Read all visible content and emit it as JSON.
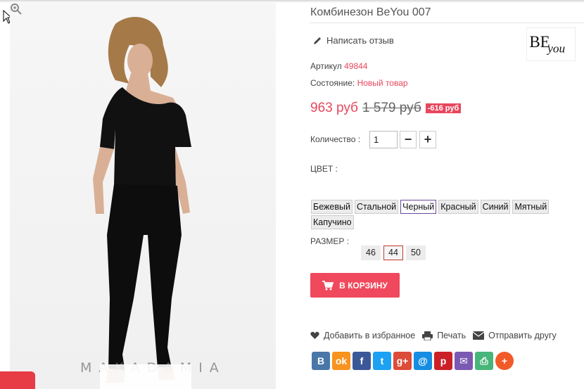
{
  "product": {
    "title": "Комбинезон BeYou 007",
    "review_link": "Написать отзыв",
    "brand_logo_text": "BE you",
    "sku_label": "Артикул",
    "sku_value": "49844",
    "condition_label": "Состояние:",
    "condition_value": "Новый товар",
    "price": "963 руб",
    "old_price": "1 579 руб",
    "discount": "-616 руб",
    "quantity_label": "Количество :",
    "quantity_value": "1",
    "color_label": "ЦВЕТ :",
    "colors": [
      "Бежевый",
      "Стальной",
      "Черный",
      "Красный",
      "Синий",
      "Мятный",
      "Капучино"
    ],
    "selected_color": "Черный",
    "size_label": "РАЗМЕР :",
    "sizes": [
      "46",
      "44",
      "50"
    ],
    "selected_size": "44",
    "cart_button": "В КОРЗИНУ",
    "watermark": "MAKADAMIA"
  },
  "actions": {
    "wishlist": "Добавить в избранное",
    "print": "Печать",
    "send": "Отправить другу"
  },
  "social": [
    {
      "name": "vk-icon",
      "glyph": "В",
      "color": "#4a76a8"
    },
    {
      "name": "odnoklassniki-icon",
      "glyph": "ok",
      "color": "#f7931e"
    },
    {
      "name": "facebook-icon",
      "glyph": "f",
      "color": "#3b5998"
    },
    {
      "name": "twitter-icon",
      "glyph": "t",
      "color": "#1da1f2"
    },
    {
      "name": "google-plus-icon",
      "glyph": "g+",
      "color": "#dd4b39"
    },
    {
      "name": "mailru-icon",
      "glyph": "@",
      "color": "#168de2"
    },
    {
      "name": "pinterest-icon",
      "glyph": "p",
      "color": "#cb2027"
    },
    {
      "name": "email-icon",
      "glyph": "✉",
      "color": "#7b58b2"
    },
    {
      "name": "print-icon",
      "glyph": "⎙",
      "color": "#48b57a"
    },
    {
      "name": "more-icon",
      "glyph": "+",
      "color": "#f25a29"
    }
  ],
  "colors": {
    "accent": "#e8475d",
    "cart_button": "#f0485c"
  }
}
